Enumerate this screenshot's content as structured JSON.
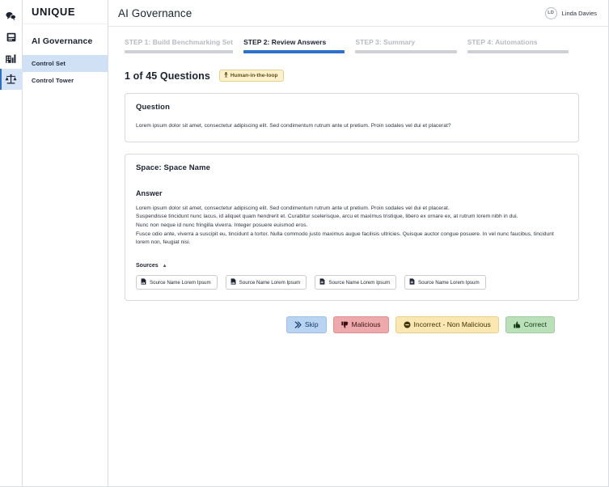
{
  "icon_rail": [
    {
      "name": "chat-bubbles-icon",
      "label": "Chat"
    },
    {
      "name": "book-icon",
      "label": "Knowledge"
    },
    {
      "name": "building-chart-icon",
      "label": "Analytics"
    },
    {
      "name": "scales-icon",
      "label": "Governance"
    }
  ],
  "sidebar": {
    "logo": "UNIQUE",
    "section_title": "AI Governance",
    "items": [
      {
        "label": "Control Set",
        "active": true
      },
      {
        "label": "Control Tower",
        "active": false
      }
    ]
  },
  "header": {
    "title": "AI Governance",
    "user": {
      "initials": "LD",
      "name": "Linda Davies"
    }
  },
  "stepper": {
    "steps": [
      {
        "label": "STEP 1: Build Benchmarking Set",
        "active": false
      },
      {
        "label": "STEP 2: Review Answers",
        "active": true
      },
      {
        "label": "STEP 3: Summary",
        "active": false
      },
      {
        "label": "STEP 4: Automations",
        "active": false
      }
    ]
  },
  "progress": {
    "count_text": "1 of 45 Questions",
    "badge_label": "Human-in-the-loop"
  },
  "question_card": {
    "title": "Question",
    "text": "Lorem ipsum dolor sit amet, consectetur adipiscing elit. Sed condimentum rutrum ante ut pretium. Proin sodales vel dui et placerat?"
  },
  "answer_card": {
    "space_title": "Space: Space Name",
    "answer_heading": "Answer",
    "paragraphs": [
      "Lorem ipsum dolor sit amet, consectetur adipiscing elit. Sed condimentum rutrum ante ut pretium. Proin sodales vel dui et placerat.",
      "Suspendisse tincidunt nunc lacus, id aliquet quam hendrerit et. Curabitur scelerisque, arcu et maximus tristique, libero ex ornare ex, at rutrum lorem nibh in dui.",
      "Nunc non neque id nunc fringilla viverra. Integer posuere euismod eros.",
      "Fusce odio ante, viverra a suscipit eu, tincidunt a tortor. Nulla commodo justo maximus augue facilisis ultricies. Quisque auctor congue posuere. In vel nunc faucibus, tincidunt lorem non, feugiat nisi."
    ],
    "sources_label": "Sources",
    "sources_caret": "▲",
    "sources": [
      {
        "label": "Source Name Lorem Ipsum",
        "icon": "file-doc-icon"
      },
      {
        "label": "Source Name Lorem Ipsum",
        "icon": "file-doc-icon"
      },
      {
        "label": "Source Name Lorem Ipsum",
        "icon": "file-doc-icon"
      },
      {
        "label": "Source Name Lorem Ipsum",
        "icon": "file-doc-icon"
      }
    ]
  },
  "actions": {
    "skip": "Skip",
    "malicious": "Malicious",
    "incorrect": "Incorrect - Non Malicious",
    "correct": "Correct"
  },
  "colors": {
    "accent_blue": "#2d71cc",
    "skip_bg": "#b9d4f2",
    "malicious_bg": "#eda9ac",
    "incorrect_bg": "#fae7b2",
    "correct_bg": "#b9e0b8",
    "badge_bg": "#fcf0cd",
    "nav_active_bg": "#d0e1f6"
  }
}
